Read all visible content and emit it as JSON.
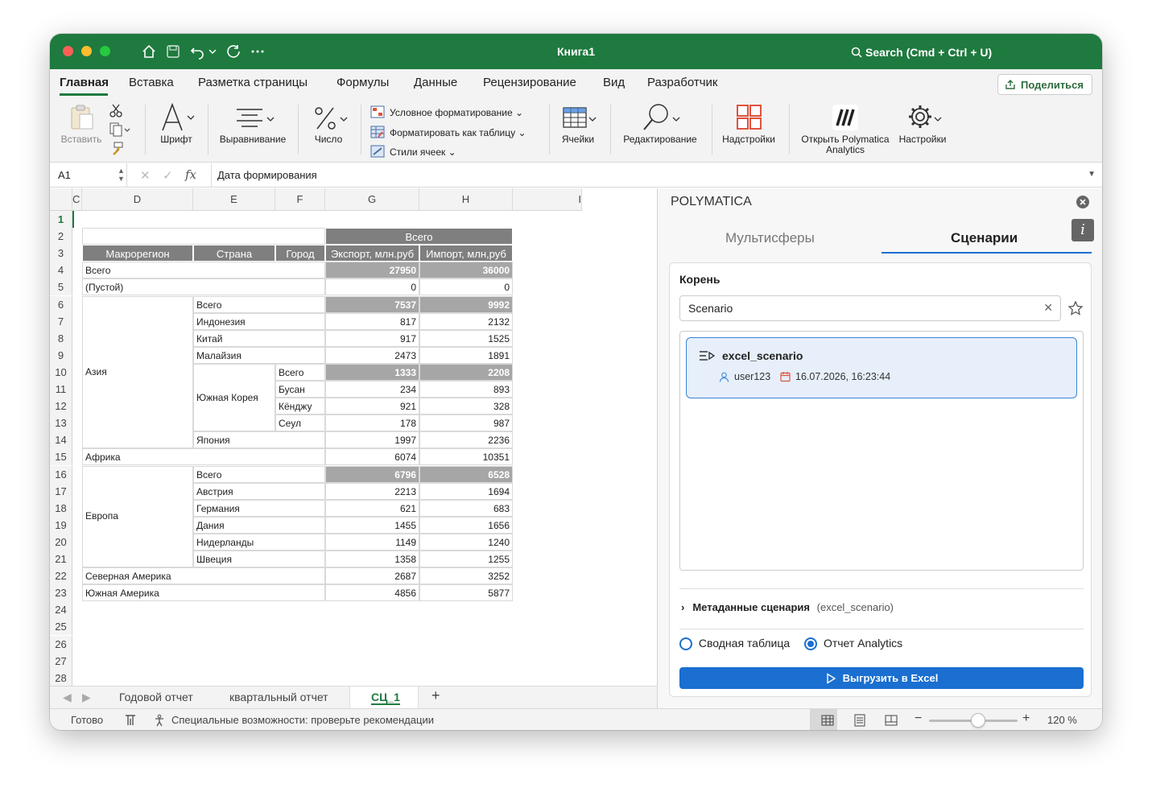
{
  "window": {
    "title": "Книга1",
    "search_placeholder": "Search (Cmd + Ctrl + U)"
  },
  "ribbon_tabs": [
    "Главная",
    "Вставка",
    "Разметка страницы",
    "Формулы",
    "Данные",
    "Рецензирование",
    "Вид",
    "Разработчик"
  ],
  "share_label": "Поделиться",
  "ribbon": {
    "paste": "Вставить",
    "font": "Шрифт",
    "align": "Выравнивание",
    "number": "Число",
    "cond_format": "Условное форматирование",
    "format_table": "Форматировать как таблицу",
    "cell_styles": "Стили ячеек",
    "cells": "Ячейки",
    "editing": "Редактирование",
    "addins": "Надстройки",
    "polymatica_line1": "Открыть Polymatica",
    "polymatica_line2": "Analytics",
    "settings": "Настройки"
  },
  "formula_bar": {
    "name_box": "A1",
    "fx": "fx",
    "value": "Дата формирования"
  },
  "columns": [
    "C",
    "D",
    "E",
    "F",
    "G",
    "H",
    "I"
  ],
  "rows": [
    "1",
    "2",
    "3",
    "4",
    "5",
    "6",
    "7",
    "8",
    "9",
    "10",
    "11",
    "12",
    "13",
    "14",
    "15",
    "16",
    "17",
    "18",
    "19",
    "20",
    "21",
    "22",
    "23",
    "24",
    "25",
    "26",
    "27",
    "28"
  ],
  "table": {
    "header_total": "Всего",
    "headers": [
      "Макрорегион",
      "Страна",
      "Город",
      "Экспорт, млн.руб",
      "Импорт, млн,руб"
    ],
    "rows": [
      {
        "label": "Всего",
        "exp": "27950",
        "imp": "36000"
      },
      {
        "label": "(Пустой)",
        "exp": "0",
        "imp": "0"
      },
      {
        "label": "Всего",
        "exp": "7537",
        "imp": "9992"
      },
      {
        "label": "Индонезия",
        "exp": "817",
        "imp": "2132"
      },
      {
        "label": "Китай",
        "exp": "917",
        "imp": "1525"
      },
      {
        "label": "Малайзия",
        "exp": "2473",
        "imp": "1891"
      },
      {
        "label": "Всего",
        "exp": "1333",
        "imp": "2208"
      },
      {
        "label": "Бусан",
        "exp": "234",
        "imp": "893"
      },
      {
        "label": "Кёнджу",
        "exp": "921",
        "imp": "328"
      },
      {
        "label": "Сеул",
        "exp": "178",
        "imp": "987"
      },
      {
        "label": "Япония",
        "exp": "1997",
        "imp": "2236"
      },
      {
        "label": "Африка",
        "exp": "6074",
        "imp": "10351"
      },
      {
        "label": "Всего",
        "exp": "6796",
        "imp": "6528"
      },
      {
        "label": "Австрия",
        "exp": "2213",
        "imp": "1694"
      },
      {
        "label": "Германия",
        "exp": "621",
        "imp": "683"
      },
      {
        "label": "Дания",
        "exp": "1455",
        "imp": "1656"
      },
      {
        "label": "Нидерланды",
        "exp": "1149",
        "imp": "1240"
      },
      {
        "label": "Швеция",
        "exp": "1358",
        "imp": "1255"
      },
      {
        "label": "Северная Америка",
        "exp": "2687",
        "imp": "3252"
      },
      {
        "label": "Южная Америка",
        "exp": "4856",
        "imp": "5877"
      }
    ],
    "merged": {
      "asia": "Азия",
      "korea": "Южная Корея",
      "europe": "Европа"
    }
  },
  "sheet_tabs": [
    "Годовой отчет",
    "квартальный отчет",
    "СЦ_1"
  ],
  "status": {
    "ready": "Готово",
    "accessibility": "Специальные возможности: проверьте рекомендации",
    "zoom": "120 %",
    "zoom_level": 0.55
  },
  "pane": {
    "title": "POLYMATICA",
    "tabs": [
      "Мультисферы",
      "Сценарии"
    ],
    "root_label": "Корень",
    "search_value": "Scenario",
    "scenario": {
      "name": "excel_scenario",
      "user": "user123",
      "date": "16.07.2026, 16:23:44"
    },
    "meta_label": "Метаданные сценария",
    "meta_value": "(excel_scenario)",
    "radio_pivot": "Сводная таблица",
    "radio_analytics": "Отчет Analytics",
    "export_button": "Выгрузить в Excel"
  },
  "colors": {
    "excel_green": "#1f7a3f",
    "accent_blue": "#1a6fd0",
    "header_gray": "#7f7f7f",
    "total_gray": "#a6a6a6"
  }
}
